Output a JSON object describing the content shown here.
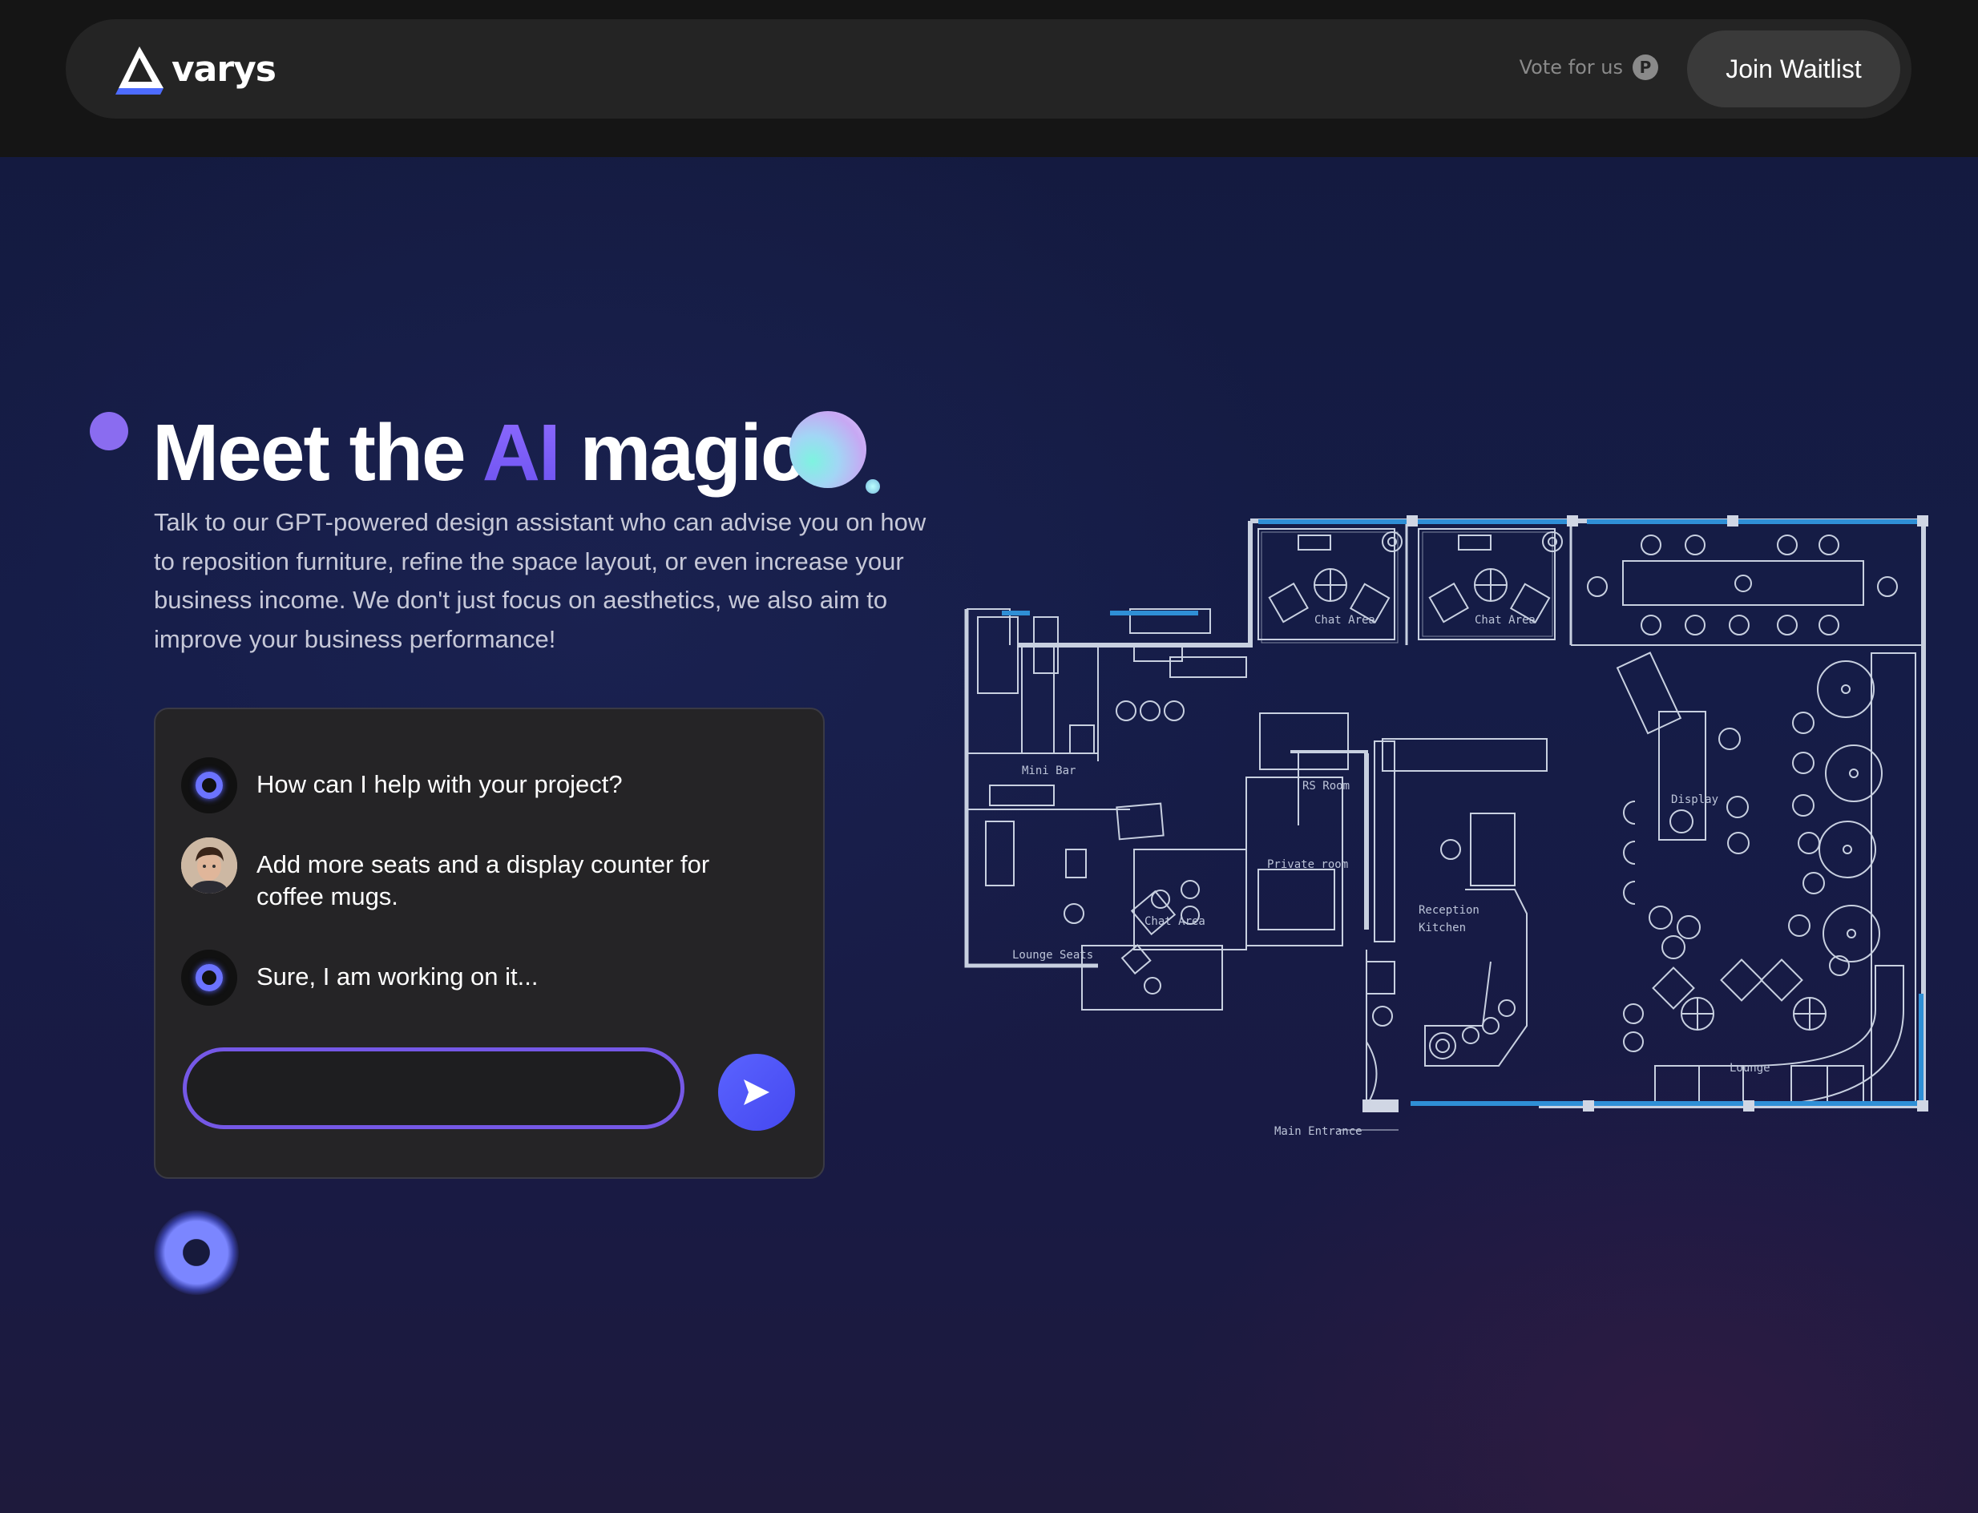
{
  "brand": {
    "name": "varys",
    "logo_icon": "triangle-logo-icon"
  },
  "nav": {
    "vote_label": "Vote for us",
    "vote_icon": "product-hunt-icon",
    "vote_icon_letter": "P",
    "join_label": "Join Waitlist"
  },
  "hero": {
    "headline_part1": "Meet the",
    "headline_accent": "AI",
    "headline_part2": "magic",
    "description": "Talk to our GPT-powered design assistant who can advise you on how to reposition furniture, refine the space layout, or even increase your business income. We don't just focus on aesthetics, we also aim to improve your business performance!"
  },
  "chat": {
    "messages": [
      {
        "sender": "assistant",
        "text": "How can I help with your project?"
      },
      {
        "sender": "user",
        "text": "Add more seats and a display counter for coffee mugs."
      },
      {
        "sender": "assistant",
        "text": "Sure, I am working on it..."
      }
    ],
    "input_value": "",
    "send_icon": "send-arrow-icon"
  },
  "floorplan": {
    "labels": {
      "chat_area_1": "Chat  Area",
      "chat_area_2": "Chat  Area",
      "chat_area_3": "Chat  Area",
      "mini_bar": "Mini  Bar",
      "rs_room": "RS  Room",
      "private_room": "Private  room",
      "lounge_seats": "Lounge  Seats",
      "reception": "Reception",
      "kitchen": "Kitchen",
      "display": "Display",
      "lounge": "Lounge",
      "main_entrance": "Main  Entrance"
    }
  },
  "colors": {
    "accent": "#6c52f0",
    "button_bg": "#3a3a3a",
    "blueprint_line": "#c8d0e0",
    "window_blue": "#2f8fd6"
  }
}
